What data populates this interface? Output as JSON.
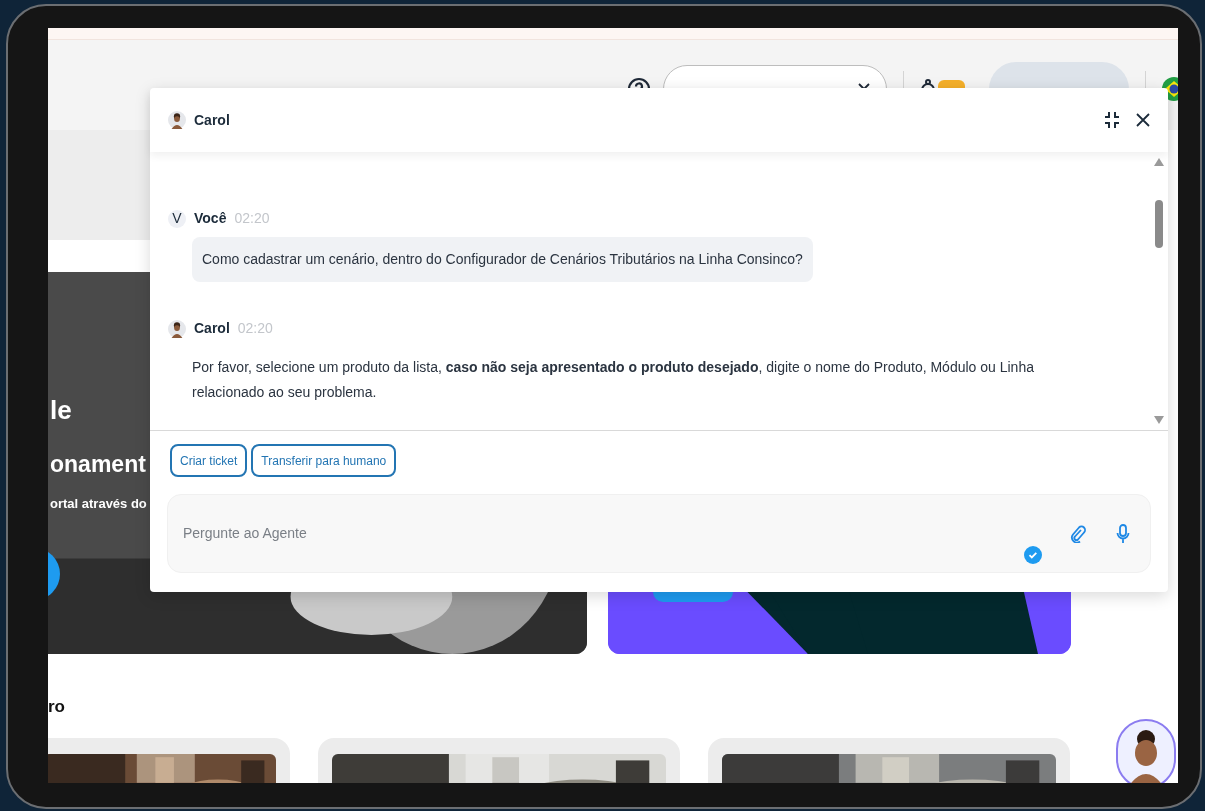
{
  "page": {
    "hero": {
      "title_lines": [
        "le",
        "onament"
      ],
      "subtitle": "ortal através do"
    },
    "section_title": "ro"
  },
  "chat": {
    "agent_name": "Carol",
    "messages": [
      {
        "kind": "user",
        "avatar": "V",
        "sender": "Você",
        "time": "02:20",
        "text": "Como cadastrar um cenário, dentro do Configurador de Cenários Tributários na Linha Consinco?"
      },
      {
        "kind": "agent",
        "sender": "Carol",
        "time": "02:20",
        "text": "Por favor, selecione um produto da lista, **caso não seja apresentado o produto desejado**, digite o nome do Produto, Módulo ou Linha relacionado ao seu problema."
      }
    ],
    "actions": [
      "Criar ticket",
      "Transferir para humano"
    ],
    "input": {
      "placeholder": "Pergunte ao Agente"
    }
  }
}
